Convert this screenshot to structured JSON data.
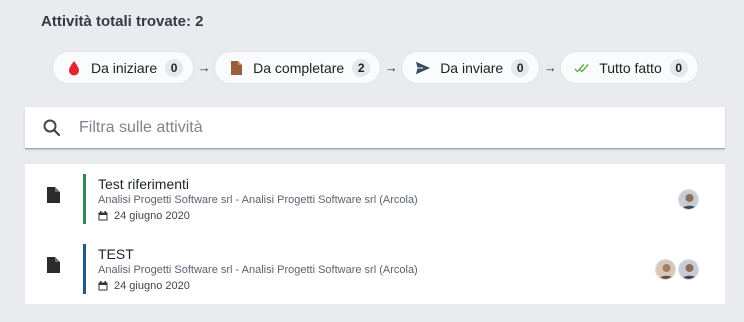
{
  "header": {
    "title": "Attività totali trovate: 2"
  },
  "steps": [
    {
      "label": "Da iniziare",
      "count": "0",
      "icon": "red-drop-icon",
      "color": "#e0262f"
    },
    {
      "label": "Da completare",
      "count": "2",
      "icon": "brown-document-icon",
      "color": "#9a5b3e"
    },
    {
      "label": "Da inviare",
      "count": "0",
      "icon": "send-icon",
      "color": "#3b4a63"
    },
    {
      "label": "Tutto fatto",
      "count": "0",
      "icon": "double-check-icon",
      "color": "#55a83a"
    }
  ],
  "arrow_glyph": "→",
  "search": {
    "placeholder": "Filtra sulle attività",
    "value": ""
  },
  "activities": [
    {
      "title": "Test riferimenti",
      "subtitle": "Analisi Progetti Software srl - Analisi Progetti Software srl (Arcola)",
      "date": "24 giugno 2020",
      "bar_color": "#2e8b57",
      "avatars": 1
    },
    {
      "title": "TEST",
      "subtitle": "Analisi Progetti Software srl - Analisi Progetti Software srl (Arcola)",
      "date": "24 giugno 2020",
      "bar_color": "#1f5a8a",
      "avatars": 2
    }
  ]
}
